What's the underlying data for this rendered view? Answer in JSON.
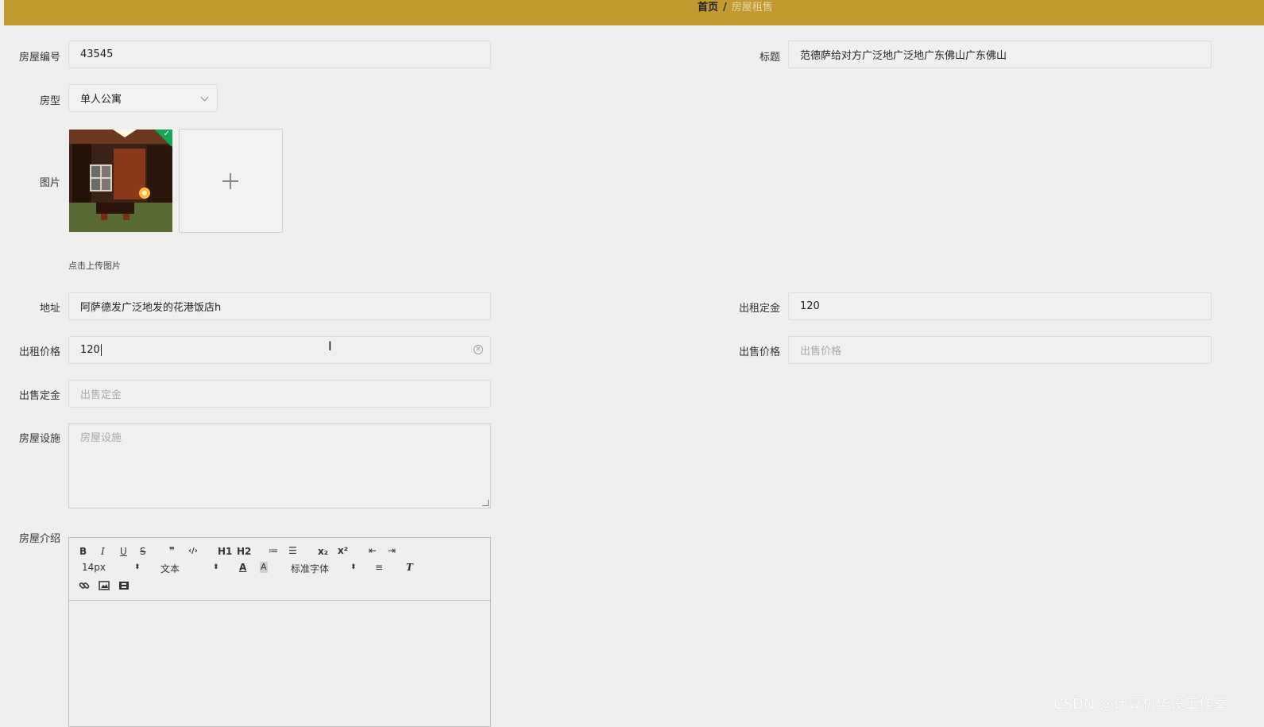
{
  "breadcrumb": {
    "home": "首页",
    "separator": "/",
    "current": "房屋租售"
  },
  "form": {
    "house_no": {
      "label": "房屋编号",
      "value": "43545"
    },
    "title": {
      "label": "标题",
      "value": "范德萨给对方广泛地广泛地广东佛山广东佛山"
    },
    "house_type": {
      "label": "房型",
      "value": "单人公寓"
    },
    "image": {
      "label": "图片",
      "hint": "点击上传图片"
    },
    "address": {
      "label": "地址",
      "value": "阿萨德发广泛地发的花港饭店h"
    },
    "rent_deposit": {
      "label": "出租定金",
      "value": "120"
    },
    "rent_price": {
      "label": "出租价格",
      "value": "120"
    },
    "sale_price": {
      "label": "出售价格",
      "placeholder": "出售价格"
    },
    "sale_deposit": {
      "label": "出售定金",
      "placeholder": "出售定金"
    },
    "facilities": {
      "label": "房屋设施",
      "placeholder": "房屋设施"
    },
    "intro": {
      "label": "房屋介绍"
    }
  },
  "editor": {
    "font_size": "14px",
    "block_type": "文本",
    "font_family": "标准字体",
    "toolbar_row1": [
      "B",
      "I",
      "U",
      "S",
      "❞",
      "‹/›",
      "H1",
      "H2",
      "≔",
      "☰",
      "x₂",
      "x²",
      "⇤",
      "⇥"
    ],
    "toolbar_row3": [
      "link",
      "image",
      "video"
    ]
  },
  "watermark": "CSDN @计算机毕设工作室",
  "colors": {
    "topbar": "#c19a2f",
    "success": "#15a356"
  }
}
